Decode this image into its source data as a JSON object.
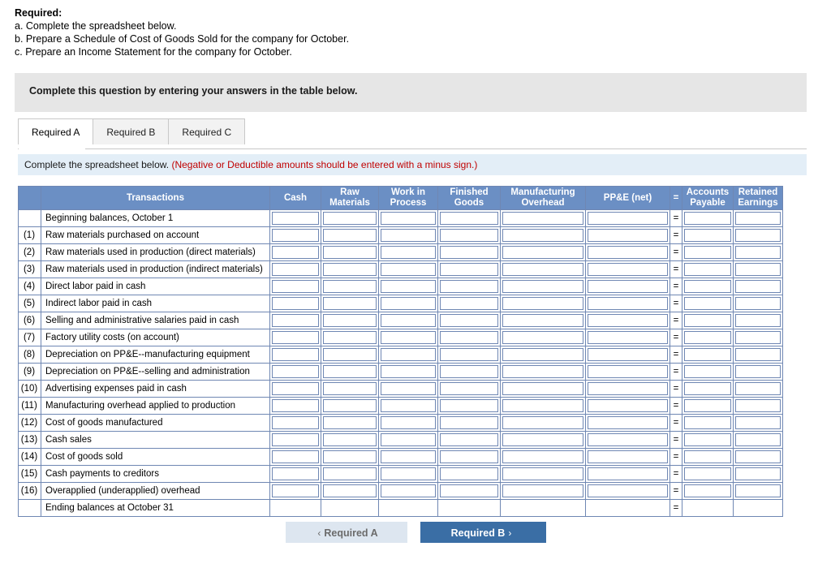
{
  "required": {
    "title": "Required:",
    "lines": [
      "a. Complete the spreadsheet below.",
      "b. Prepare a Schedule of Cost of Goods Sold for the company for October.",
      "c. Prepare an Income Statement for the company for October."
    ]
  },
  "instruction_bar": {
    "text": "Complete this question by entering your answers in the table below."
  },
  "tabs": [
    {
      "label": "Required A",
      "active": true
    },
    {
      "label": "Required B",
      "active": false
    },
    {
      "label": "Required C",
      "active": false
    }
  ],
  "blue_strip": {
    "text": "Complete the spreadsheet below.",
    "note": "(Negative or Deductible amounts should be entered with a minus sign.)"
  },
  "sheet": {
    "headers": {
      "corner": "",
      "transactions": "Transactions",
      "cash": "Cash",
      "raw_materials": "Raw\nMaterials",
      "raw_materials_l1": "Raw",
      "raw_materials_l2": "Materials",
      "work_in_process_l1": "Work in",
      "work_in_process_l2": "Process",
      "finished_goods_l1": "Finished",
      "finished_goods_l2": "Goods",
      "manufacturing_overhead_l1": "Manufacturing",
      "manufacturing_overhead_l2": "Overhead",
      "ppe_net": "PP&E (net)",
      "equals": "=",
      "accounts_payable_l1": "Accounts",
      "accounts_payable_l2": "Payable",
      "retained_earnings_l1": "Retained",
      "retained_earnings_l2": "Earnings"
    },
    "rows": [
      {
        "num": "",
        "label": "Beginning balances, October 1",
        "equals": "="
      },
      {
        "num": "(1)",
        "label": "Raw materials purchased on account",
        "equals": "="
      },
      {
        "num": "(2)",
        "label": "Raw materials used in production (direct materials)",
        "equals": "="
      },
      {
        "num": "(3)",
        "label": "Raw materials used in production (indirect materials)",
        "equals": "="
      },
      {
        "num": "(4)",
        "label": "Direct labor paid in cash",
        "equals": "="
      },
      {
        "num": "(5)",
        "label": "Indirect labor paid in cash",
        "equals": "="
      },
      {
        "num": "(6)",
        "label": "Selling and administrative salaries paid in cash",
        "equals": "="
      },
      {
        "num": "(7)",
        "label": "Factory utility costs (on account)",
        "equals": "="
      },
      {
        "num": "(8)",
        "label": "Depreciation on PP&E--manufacturing equipment",
        "equals": "="
      },
      {
        "num": "(9)",
        "label": "Depreciation on PP&E--selling and administration",
        "equals": "="
      },
      {
        "num": "(10)",
        "label": "Advertising expenses paid in cash",
        "equals": "="
      },
      {
        "num": "(11)",
        "label": "Manufacturing overhead applied to production",
        "equals": "="
      },
      {
        "num": "(12)",
        "label": "Cost of goods manufactured",
        "equals": "="
      },
      {
        "num": "(13)",
        "label": "Cash sales",
        "equals": "="
      },
      {
        "num": "(14)",
        "label": "Cost of goods sold",
        "equals": "="
      },
      {
        "num": "(15)",
        "label": "Cash payments to creditors",
        "equals": "="
      },
      {
        "num": "(16)",
        "label": "Overapplied (underapplied) overhead",
        "equals": "="
      },
      {
        "num": "",
        "label": "Ending balances at October 31",
        "equals": "=",
        "total": true
      }
    ]
  },
  "nav": {
    "prev_label": "Required A",
    "prev_chevron": "‹",
    "next_label": "Required B",
    "next_chevron": "›"
  },
  "colors": {
    "header_blue": "#6b8fc4",
    "strip_blue": "#e3eef7",
    "grey_bar": "#e6e6e6",
    "button_blue": "#3a6ea5",
    "note_red": "#c00000"
  }
}
